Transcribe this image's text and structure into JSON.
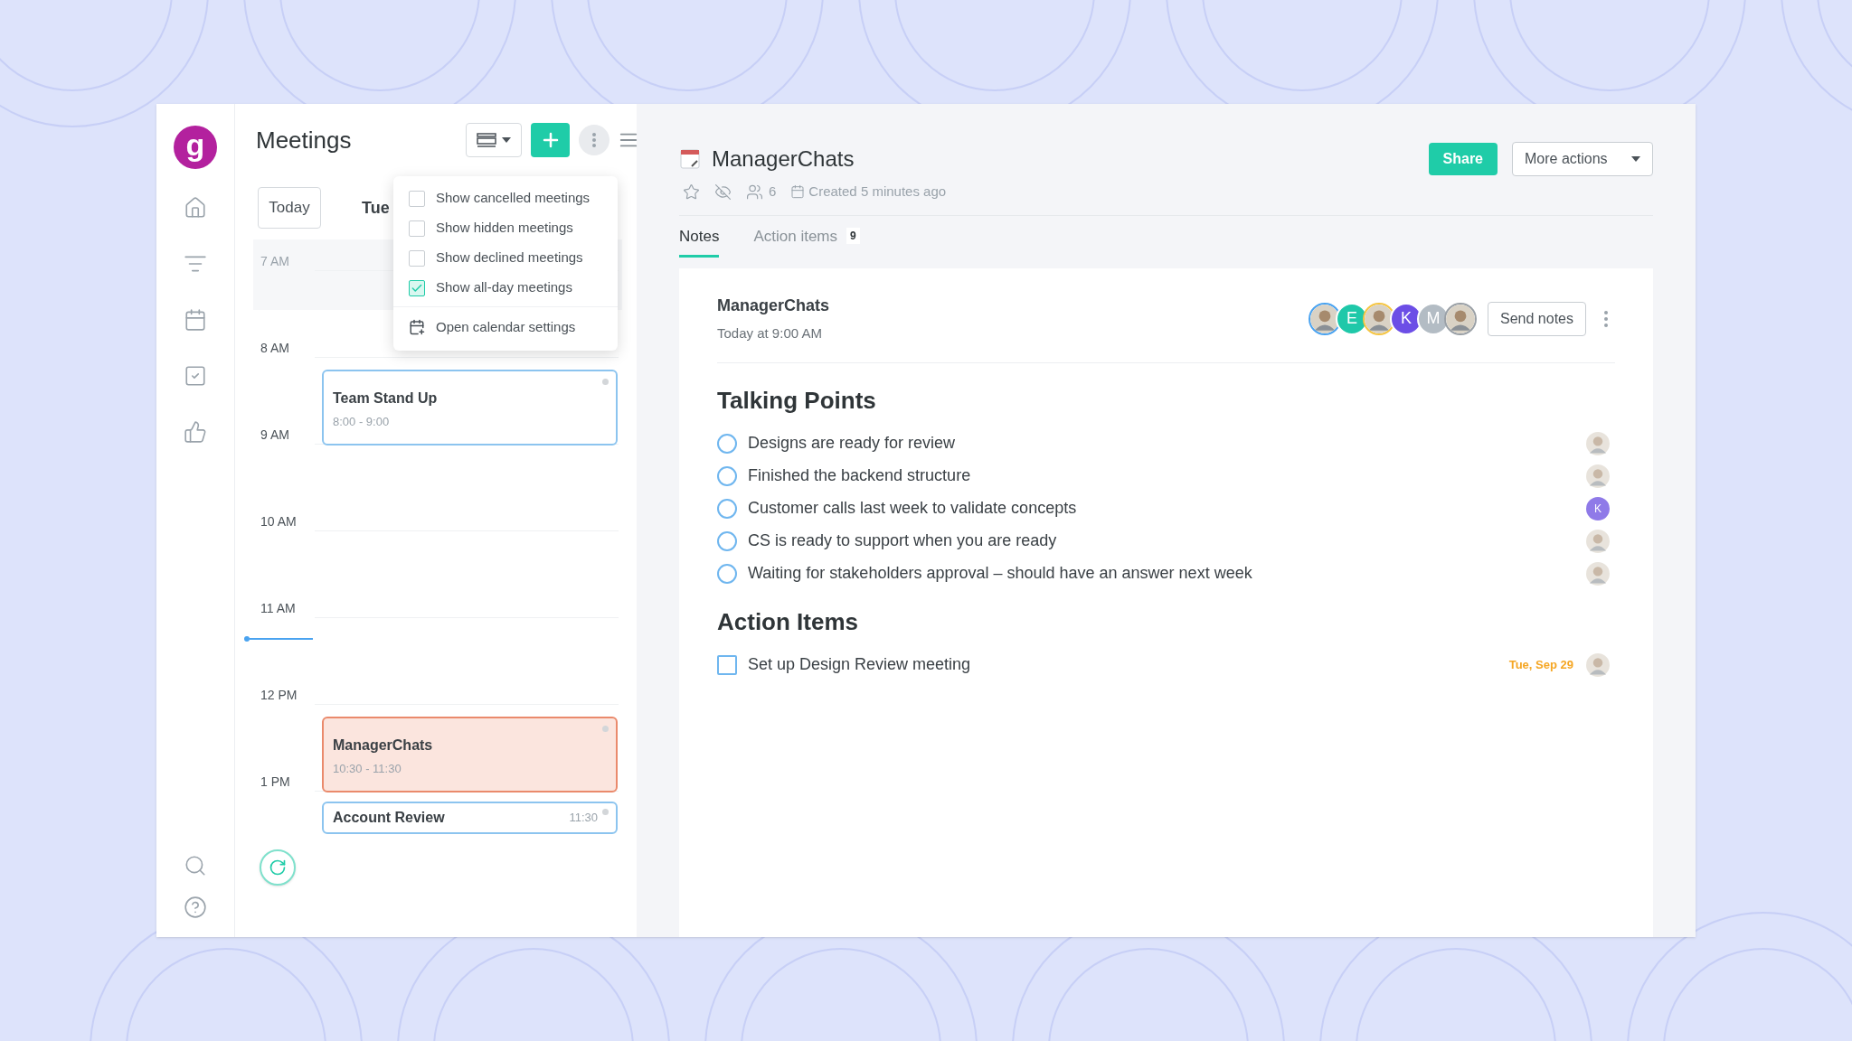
{
  "brand": {
    "letter": "g"
  },
  "meetings_panel": {
    "title": "Meetings",
    "today_button": "Today",
    "date_label": "Tue",
    "hours": [
      "7 AM",
      "8 AM",
      "9 AM",
      "10 AM",
      "11 AM",
      "12 PM",
      "1 PM"
    ],
    "events": [
      {
        "title": "Team Stand Up",
        "time": "8:00 - 9:00",
        "kind": "block",
        "selected": false
      },
      {
        "title": "ManagerChats",
        "time": "10:30 - 11:30",
        "kind": "block",
        "selected": true
      },
      {
        "title": "Account Review",
        "time": "11:30",
        "kind": "compact",
        "selected": false
      }
    ]
  },
  "options_menu": {
    "items": [
      {
        "label": "Show cancelled meetings",
        "checked": false
      },
      {
        "label": "Show hidden meetings",
        "checked": false
      },
      {
        "label": "Show declined meetings",
        "checked": false
      },
      {
        "label": "Show all-day meetings",
        "checked": true
      }
    ],
    "settings_link": "Open calendar settings"
  },
  "meeting": {
    "title": "ManagerChats",
    "attendee_count": "6",
    "created": "Created 5 minutes ago",
    "share_button": "Share",
    "more_actions": "More actions",
    "tabs": [
      {
        "label": "Notes",
        "selected": true
      },
      {
        "label": "Action items",
        "count": "9",
        "selected": false
      }
    ],
    "note": {
      "title": "ManagerChats",
      "subtitle": "Today at 9:00 AM",
      "send_button": "Send notes",
      "attendees": [
        {
          "kind": "photo",
          "color": "#4aa3f0"
        },
        {
          "kind": "letter",
          "letter": "E",
          "color": "#1fc8a9"
        },
        {
          "kind": "photo",
          "color": "#f5c542"
        },
        {
          "kind": "letter",
          "letter": "K",
          "color": "#6c4ee6"
        },
        {
          "kind": "letter",
          "letter": "M",
          "color": "#b3bcc4"
        },
        {
          "kind": "photo",
          "color": "#9aa0a6"
        }
      ],
      "talking_points_heading": "Talking Points",
      "talking_points": [
        {
          "text": "Designs are ready for review",
          "checked": false,
          "assignee": {
            "kind": "photo"
          }
        },
        {
          "text": "Finished the backend structure",
          "checked": false,
          "assignee": {
            "kind": "photo"
          }
        },
        {
          "text": "Customer calls last week to validate concepts",
          "checked": false,
          "assignee": {
            "kind": "letter",
            "letter": "K"
          }
        },
        {
          "text": "CS is ready to support when you are ready",
          "checked": false,
          "assignee": {
            "kind": "photo"
          }
        },
        {
          "text": "Waiting for stakeholders approval – should have an answer next week",
          "checked": false,
          "assignee": {
            "kind": "photo"
          }
        }
      ],
      "action_items_heading": "Action Items",
      "action_items": [
        {
          "text": "Set up Design Review meeting",
          "checked": false,
          "due": "Tue, Sep 29",
          "assignee": {
            "kind": "photo"
          }
        }
      ]
    }
  }
}
